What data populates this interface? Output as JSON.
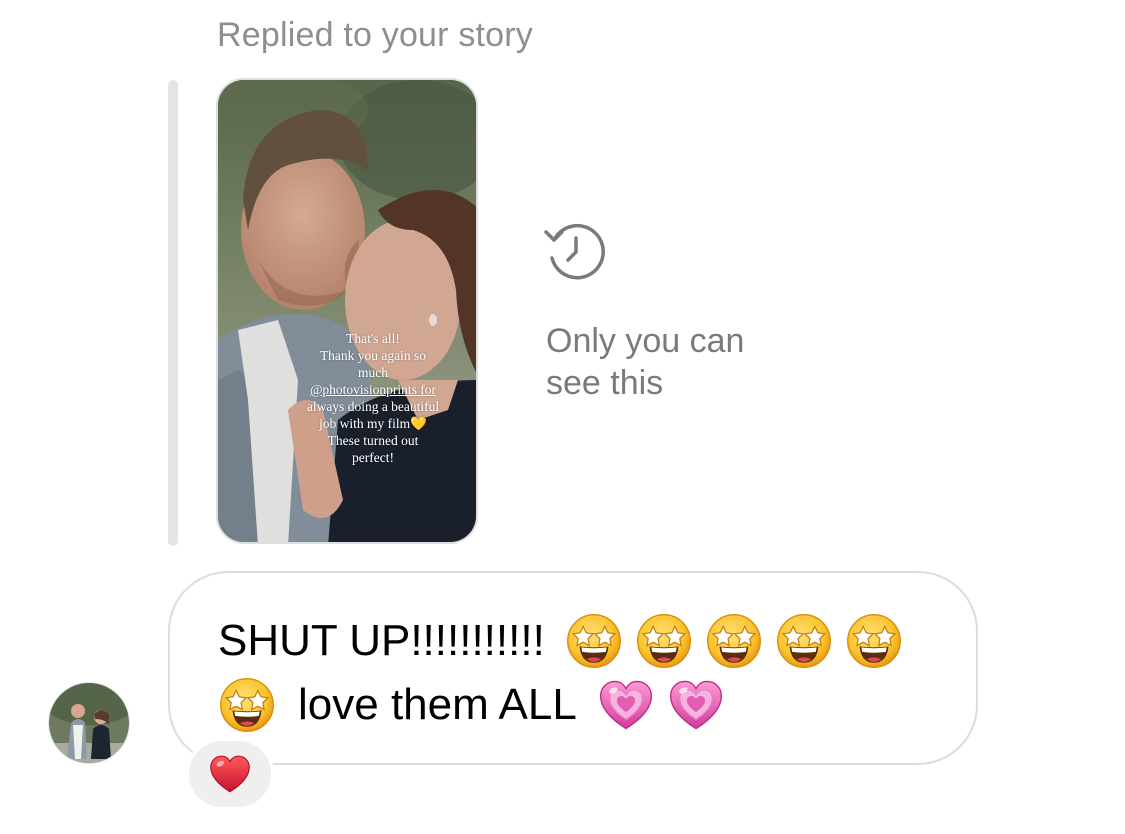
{
  "header": {
    "replied_label": "Replied to your story"
  },
  "story": {
    "caption_lines": [
      "That's all!",
      "Thank you again so",
      "much",
      "@photovisionprints for",
      "always doing a beautiful",
      "job with my film💛",
      "These turned out",
      "perfect!"
    ],
    "mention": "@photovisionprints"
  },
  "visibility": {
    "icon": "history-icon",
    "line1": "Only you can",
    "line2": "see this"
  },
  "message": {
    "line1_text": "SHUT UP!!!!!!!!!!!",
    "line1_emojis": [
      "star-struck",
      "star-struck",
      "star-struck",
      "star-struck",
      "star-struck"
    ],
    "line2_lead_emoji": "star-struck",
    "line2_text": "love them ALL",
    "line2_emojis": [
      "pink-heart",
      "pink-heart"
    ]
  },
  "reaction": {
    "emoji": "red-heart"
  },
  "colors": {
    "muted_text": "#8e8e8e",
    "bubble_border": "#dcdcdc",
    "reaction_bg": "#efefef",
    "heart_red": "#e0243a",
    "heart_pink": "#e45fb7"
  }
}
